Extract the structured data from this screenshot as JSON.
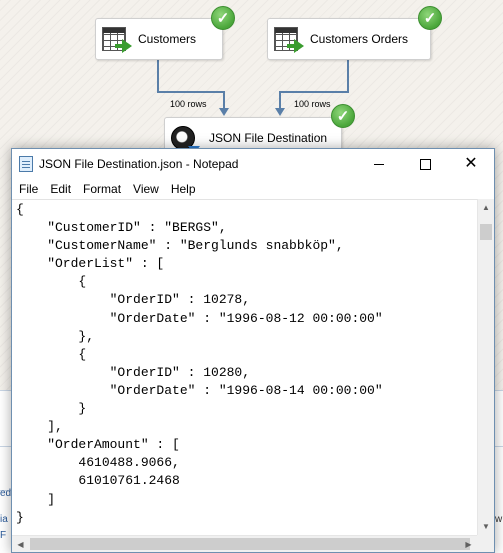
{
  "designer": {
    "tasks": [
      {
        "label": "Customers",
        "status": "success"
      },
      {
        "label": "Customers Orders",
        "status": "success"
      },
      {
        "label": "JSON File Destination",
        "status": "success"
      }
    ],
    "paths": [
      {
        "label": "100 rows"
      },
      {
        "label": "100 rows"
      }
    ],
    "colors": {
      "connector": "#5a7fa8",
      "success": "#4aa63a"
    }
  },
  "notepad": {
    "title": "JSON File Destination.json - Notepad",
    "menu": [
      "File",
      "Edit",
      "Format",
      "View",
      "Help"
    ],
    "content": "{\n    \"CustomerID\" : \"BERGS\",\n    \"CustomerName\" : \"Berglunds snabbköp\",\n    \"OrderList\" : [\n        {\n            \"OrderID\" : 10278,\n            \"OrderDate\" : \"1996-08-12 00:00:00\"\n        },\n        {\n            \"OrderID\" : 10280,\n            \"OrderDate\" : \"1996-08-14 00:00:00\"\n        }\n    ],\n    \"OrderAmount\" : [\n        4610488.9066,\n        61010761.2468\n    ]\n}"
  },
  "background": {
    "left_fragments": [
      "ed",
      "ia",
      "F"
    ],
    "right_fragments": [
      "w"
    ]
  }
}
